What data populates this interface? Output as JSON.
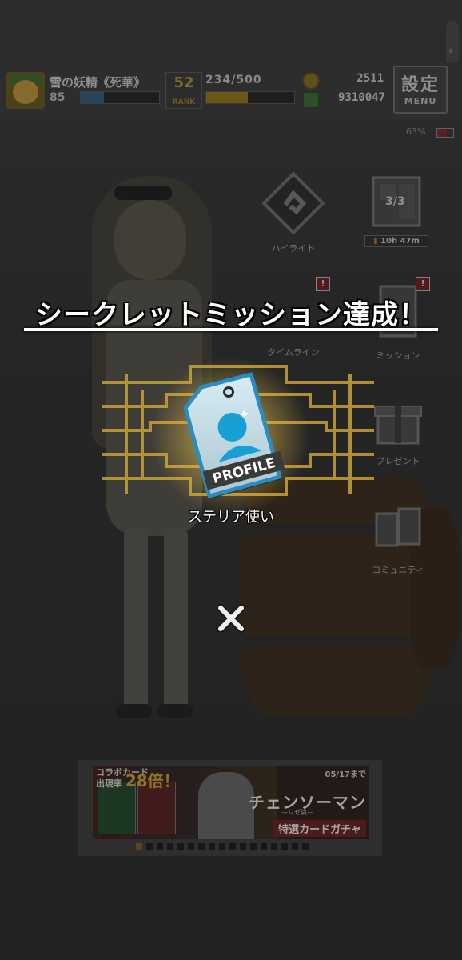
{
  "hud": {
    "player_name": "雪の妖精《死華》",
    "player_level": "85",
    "exp_progress": 0.3,
    "rank_number": "52",
    "rank_label": "RANK",
    "stamina": "234/500",
    "stamina_progress": 0.47,
    "coin_value": "2511",
    "gem_value": "9310047",
    "settings_label": "設定",
    "menu_label": "MENU",
    "battery": "63%"
  },
  "menu": {
    "highlight_label": "ハイライト",
    "timeline_label": "タイムライン",
    "mission_label": "ミッション",
    "present_label": "プレゼント",
    "community_label": "コミュニティ",
    "deck_count": "3/3",
    "timer": "10h 47m",
    "badge": "!"
  },
  "overlay": {
    "title": "シークレットミッション達成！",
    "reward_tag_text": "PROFILE",
    "reward_name": "ステリア使い",
    "close_symbol": "✕"
  },
  "banner": {
    "collab_line1": "コラボカード",
    "collab_line2": "出現率",
    "collab_rate": "28倍！",
    "date": "05/17まで",
    "title": "チェンソーマン",
    "subtitle": "—レゼ篇—",
    "gacha": "特選カードガチャ",
    "total_dots": 17,
    "active_dot": 1
  },
  "colors": {
    "accent_gold": "#e8c04a",
    "profile_blue": "#1aa7d8",
    "badge_red": "#7a1e1e"
  }
}
